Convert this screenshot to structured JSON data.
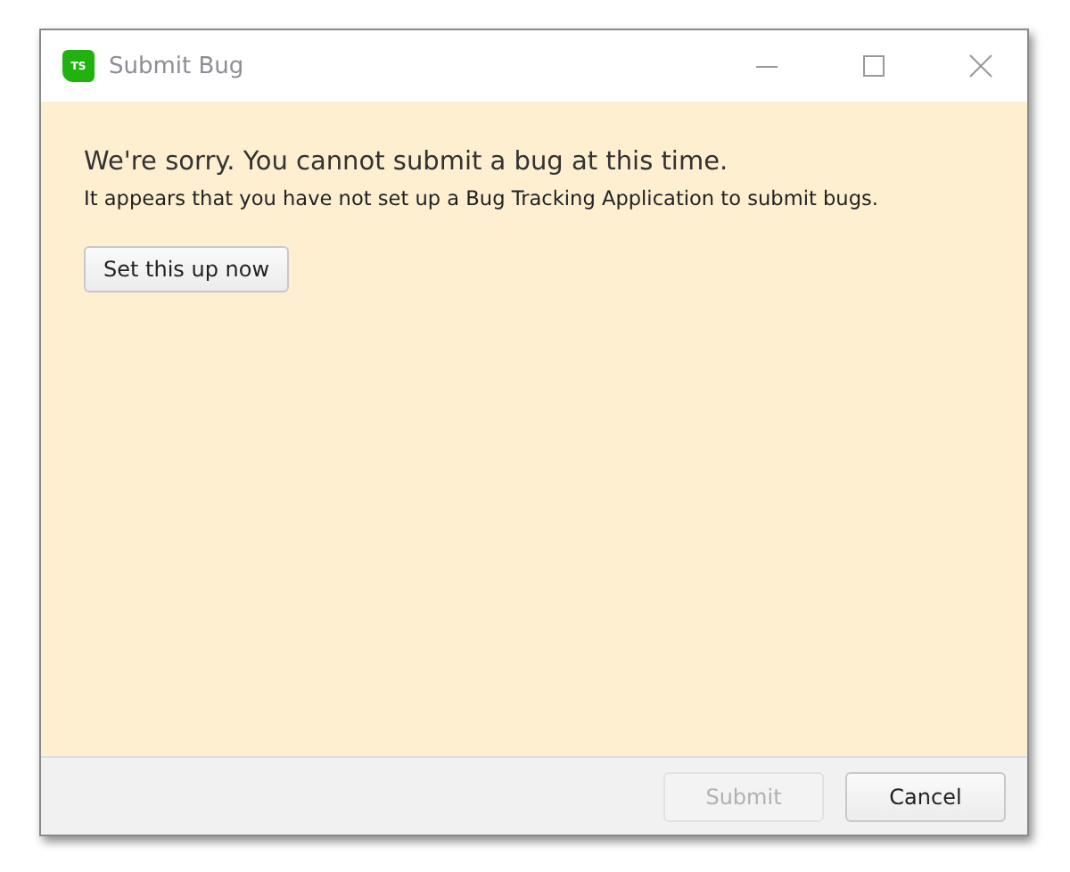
{
  "window": {
    "title": "Submit Bug",
    "icon_label": "TS"
  },
  "message": {
    "heading": "We're sorry. You cannot submit a bug at this time.",
    "detail": "It appears that you have not set up a Bug Tracking Application to submit bugs."
  },
  "setup_button": {
    "label": "Set this up now"
  },
  "buttons": [
    {
      "label": "Submit",
      "disabled": true
    },
    {
      "label": "Cancel",
      "disabled": false
    }
  ]
}
